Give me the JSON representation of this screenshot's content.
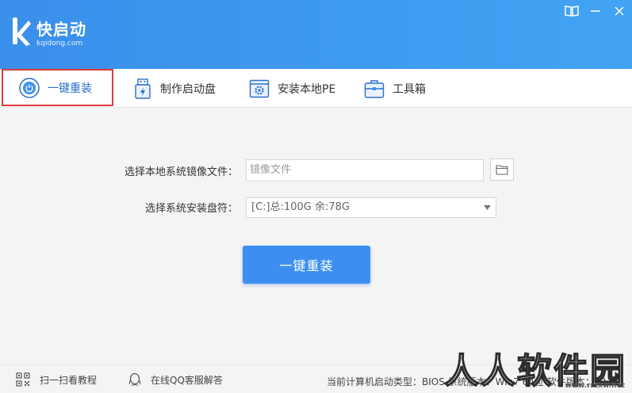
{
  "app": {
    "name": "快启动",
    "domain": "kqidong.com"
  },
  "window_controls": [
    {
      "icon": "book-icon"
    },
    {
      "icon": "minimize-icon"
    },
    {
      "icon": "close-icon"
    }
  ],
  "tabs": [
    {
      "label": "一键重装",
      "icon": "power-icon",
      "active": true
    },
    {
      "label": "制作启动盘",
      "icon": "usb-icon",
      "active": false
    },
    {
      "label": "安装本地PE",
      "icon": "gear-window-icon",
      "active": false
    },
    {
      "label": "工具箱",
      "icon": "toolbox-icon",
      "active": false
    }
  ],
  "form": {
    "image_label": "选择本地系统镜像文件：",
    "image_placeholder": "镜像文件",
    "drive_label": "选择系统安装盘符：",
    "drive_value": "[C:]总:100G 余:78G",
    "install_button": "一键重装"
  },
  "footer": {
    "scan_tutorial": "扫一扫看教程",
    "online_support": "在线QQ客服解答",
    "status": "当前计算机启动类型：BIOS  系统版本：Win7 64位  软件版本：v2.0"
  },
  "watermark": {
    "text": "人人软件园",
    "url": "www.rrzxw.net"
  },
  "colors": {
    "header": "#3e9bf0",
    "accent": "#3c8ff0",
    "active_border": "#e03a3a"
  }
}
